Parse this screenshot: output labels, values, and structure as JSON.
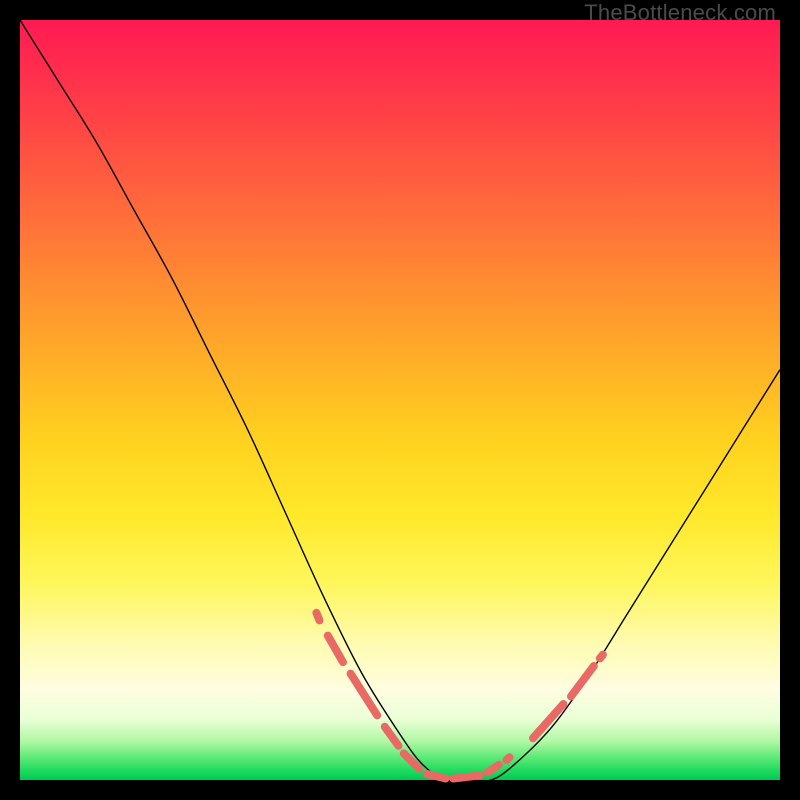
{
  "watermark": "TheBottleneck.com",
  "chart_data": {
    "type": "line",
    "title": "",
    "xlabel": "",
    "ylabel": "",
    "xlim": [
      0,
      100
    ],
    "ylim": [
      0,
      100
    ],
    "grid": false,
    "series": [
      {
        "name": "bottleneck-curve",
        "x": [
          0,
          5,
          10,
          15,
          20,
          25,
          30,
          35,
          40,
          45,
          50,
          53,
          56,
          59,
          62,
          65,
          70,
          75,
          80,
          85,
          90,
          95,
          100
        ],
        "values": [
          100,
          92,
          84,
          75,
          66,
          56,
          46,
          35,
          24,
          14,
          6,
          2,
          0,
          0,
          0,
          2,
          7,
          14,
          22,
          30,
          38,
          46,
          54
        ]
      }
    ],
    "highlight_dashes": {
      "name": "optimal-range-markers",
      "color": "#e96a64",
      "segments": [
        {
          "x": [
            39,
            39.4
          ],
          "y": [
            22,
            21
          ]
        },
        {
          "x": [
            40.5,
            42.5
          ],
          "y": [
            19,
            15.5
          ]
        },
        {
          "x": [
            43.5,
            47
          ],
          "y": [
            14,
            8.5
          ]
        },
        {
          "x": [
            48,
            49.8
          ],
          "y": [
            7,
            4.5
          ]
        },
        {
          "x": [
            50.5,
            52.5
          ],
          "y": [
            3.5,
            1.5
          ]
        },
        {
          "x": [
            53.5,
            56
          ],
          "y": [
            0.8,
            0.2
          ]
        },
        {
          "x": [
            57,
            60.5
          ],
          "y": [
            0.2,
            0.6
          ]
        },
        {
          "x": [
            61.5,
            63
          ],
          "y": [
            1,
            2
          ]
        },
        {
          "x": [
            64,
            64.4
          ],
          "y": [
            2.6,
            3
          ]
        },
        {
          "x": [
            67.5,
            71.5
          ],
          "y": [
            5.5,
            10
          ]
        },
        {
          "x": [
            72.5,
            75.5
          ],
          "y": [
            11,
            15
          ]
        },
        {
          "x": [
            76.3,
            76.7
          ],
          "y": [
            16,
            16.5
          ]
        }
      ]
    },
    "background_gradient": {
      "top": "#ff1a52",
      "middle": "#ffe82a",
      "bottom": "#00c853"
    }
  }
}
